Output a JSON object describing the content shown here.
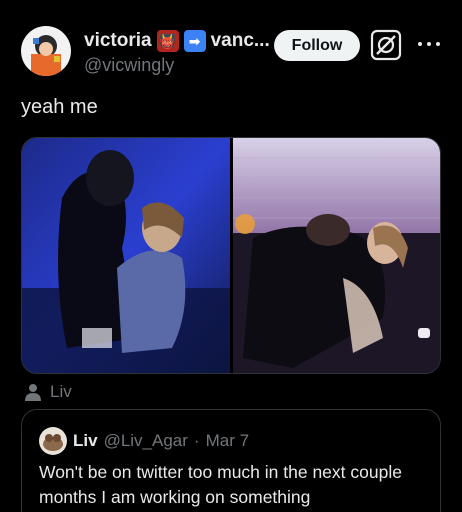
{
  "author": {
    "display_name": "victoria",
    "name_truncated": "vanc...",
    "handle": "@vicwingly",
    "emoji_1": "👹",
    "emoji_2": "➡"
  },
  "actions": {
    "follow_label": "Follow"
  },
  "tweet": {
    "text": "yeah me"
  },
  "tagged": {
    "name": "Liv"
  },
  "quote": {
    "name": "Liv",
    "handle": "@Liv_Agar",
    "separator": "·",
    "date": "Mar 7",
    "text": "Won't be on twitter too much in the next couple months I am working on something"
  },
  "colors": {
    "background": "#000000",
    "text_primary": "#e7e9ea",
    "text_secondary": "#71767b",
    "border": "#2f3336",
    "follow_bg": "#eff3f4"
  }
}
